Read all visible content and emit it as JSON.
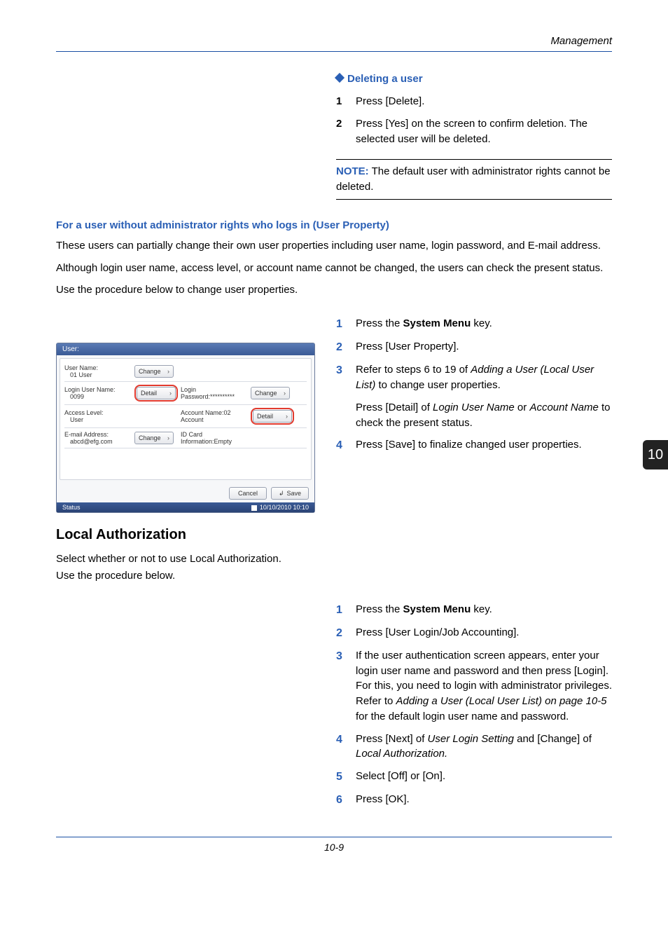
{
  "header": {
    "section": "Management"
  },
  "deleting": {
    "title": "Deleting a user",
    "steps": [
      {
        "n": "1",
        "text": "Press [Delete]."
      },
      {
        "n": "2",
        "text": "Press [Yes] on the screen to confirm deletion. The selected user will be deleted."
      }
    ],
    "note_label": "NOTE:",
    "note_text": " The default user with administrator rights cannot be deleted."
  },
  "userprop": {
    "title": "For a user without administrator rights who logs in (User Property)",
    "p1": "These users can partially change their own user properties including user name, login password, and E-mail address.",
    "p2": "Although login user name, access level, or account name cannot be changed, the users can check the present status.",
    "p3": "Use the procedure below to change user properties.",
    "steps": {
      "s1_pre": "Press the ",
      "s1_bold": "System Menu",
      "s1_post": " key.",
      "s2": "Press [User Property].",
      "s3_pre": "Refer to steps 6 to 19 of ",
      "s3_it": "Adding a User (Local User List)",
      "s3_post": " to change user properties.",
      "s3b_pre": "Press [Detail] of ",
      "s3b_it1": "Login User Name",
      "s3b_mid": " or ",
      "s3b_it2": "Account Name",
      "s3b_post": " to check the present status.",
      "s4": "Press [Save] to finalize changed user properties."
    }
  },
  "ui": {
    "title": "User:",
    "rows": {
      "r1": {
        "label": "User Name:",
        "value": "01  User",
        "btn": "Change"
      },
      "r2": {
        "label": "Login User Name:",
        "value": "0099",
        "btn": "Detail",
        "rlabel": "Login Password:",
        "rvalue": "**********",
        "rbtn": "Change"
      },
      "r3": {
        "label": "Access Level:",
        "value": "User",
        "rlabel": "Account Name:",
        "rvalue": "02 Account",
        "rbtn": "Detail"
      },
      "r4": {
        "label": "E-mail Address:",
        "value": "abcd@efg.com",
        "btn": "Change",
        "rlabel": "ID Card Information:",
        "rvalue": "Empty"
      }
    },
    "cancel": "Cancel",
    "save": "Save",
    "status": "Status",
    "timestamp": "10/10/2010  10:10"
  },
  "local": {
    "title": "Local Authorization",
    "p1": "Select whether or not to use Local Authorization.",
    "p2": "Use the procedure below.",
    "steps": {
      "s1_pre": "Press the ",
      "s1_bold": "System Menu",
      "s1_post": " key.",
      "s2": "Press [User Login/Job Accounting].",
      "s3_pre": "If the user authentication screen appears, enter your login user name and password and then press [Login]. For this, you need to login with administrator privileges. Refer to ",
      "s3_it": "Adding a User (Local User List) on page 10-5",
      "s3_post": " for the default login user name and password.",
      "s4_pre": "Press [Next] of ",
      "s4_it1": "User Login Setting",
      "s4_mid": " and [Change] of ",
      "s4_it2": "Local Authorization.",
      "s5": "Select [Off] or [On].",
      "s6": "Press [OK]."
    }
  },
  "sidetab": "10",
  "footer": "10-9"
}
